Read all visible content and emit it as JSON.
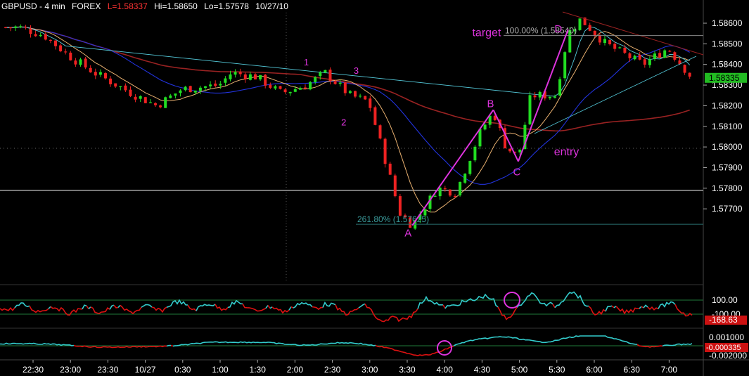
{
  "header": {
    "symbol": "GBPUSD - 4 min",
    "market": "FOREX",
    "last": "L=1.58337",
    "high": "Hi=1.58650",
    "low": "Lo=1.57578",
    "date": "10/27/10"
  },
  "colors": {
    "background": "#000000",
    "bull": "#22dd22",
    "bear": "#ee2222",
    "annotation": "#dd33dd",
    "ma_orange": "#e8b070",
    "ma_blue": "#2233dd",
    "ma_red": "#992222",
    "ma_cyan": "#55ccdd",
    "hline": "#c8c8c8",
    "osc_cyan": "#33cccc",
    "osc_red": "#dd1111"
  },
  "chart_data": [
    {
      "type": "candlestick",
      "title": "GBPUSD - 4 min",
      "ylim": [
        1.576,
        1.5866
      ],
      "yticks": [
        "1.58600",
        "1.58500",
        "1.58400",
        "1.58300",
        "1.58200",
        "1.58100",
        "1.58000",
        "1.57900",
        "1.57800",
        "1.57700"
      ],
      "x_labels": [
        "22:30",
        "23:00",
        "23:30",
        "10/27",
        "0:30",
        "1:00",
        "1:30",
        "2:00",
        "2:30",
        "3:00",
        "3:30",
        "4:00",
        "4:30",
        "5:00",
        "5:30",
        "6:00",
        "6:30",
        "7:00"
      ],
      "last_price_label": "1.58335",
      "horizontal_line": 1.5779,
      "series_close_path": [
        {
          "t": "22:20",
          "v": 1.5858
        },
        {
          "t": "22:40",
          "v": 1.5854
        },
        {
          "t": "23:00",
          "v": 1.5844
        },
        {
          "t": "23:20",
          "v": 1.5836
        },
        {
          "t": "23:50",
          "v": 1.5826
        },
        {
          "t": "0:10",
          "v": 1.582
        },
        {
          "t": "0:30",
          "v": 1.5828
        },
        {
          "t": "1:00",
          "v": 1.583
        },
        {
          "t": "1:10",
          "v": 1.5836
        },
        {
          "t": "1:30",
          "v": 1.5834
        },
        {
          "t": "1:50",
          "v": 1.5826
        },
        {
          "t": "2:10",
          "v": 1.583
        },
        {
          "t": "2:25",
          "v": 1.5836
        },
        {
          "t": "2:45",
          "v": 1.5825
        },
        {
          "t": "3:00",
          "v": 1.5822
        },
        {
          "t": "3:15",
          "v": 1.579
        },
        {
          "t": "3:25",
          "v": 1.5768
        },
        {
          "t": "3:35",
          "v": 1.5762
        },
        {
          "t": "3:55",
          "v": 1.578
        },
        {
          "t": "4:10",
          "v": 1.5778
        },
        {
          "t": "4:30",
          "v": 1.5808
        },
        {
          "t": "4:40",
          "v": 1.5817
        },
        {
          "t": "4:50",
          "v": 1.58
        },
        {
          "t": "5:00",
          "v": 1.5795
        },
        {
          "t": "5:10",
          "v": 1.5825
        },
        {
          "t": "5:30",
          "v": 1.5825
        },
        {
          "t": "5:40",
          "v": 1.5855
        },
        {
          "t": "5:50",
          "v": 1.5862
        },
        {
          "t": "6:10",
          "v": 1.585
        },
        {
          "t": "6:40",
          "v": 1.584
        },
        {
          "t": "7:00",
          "v": 1.5848
        },
        {
          "t": "7:20",
          "v": 1.5833
        }
      ],
      "annotations": [
        {
          "text": "1",
          "t": "2:10",
          "v": 1.58395
        },
        {
          "text": "2",
          "t": "2:40",
          "v": 1.58105
        },
        {
          "text": "3",
          "t": "2:50",
          "v": 1.58355
        },
        {
          "text": "A",
          "t": "3:35",
          "v": 1.5762
        },
        {
          "text": "B",
          "t": "4:40",
          "v": 1.5818
        },
        {
          "text": "C",
          "t": "5:00",
          "v": 1.5793
        },
        {
          "text": "D",
          "t": "5:40",
          "v": 1.5857
        },
        {
          "text": "entry",
          "t": "5:15",
          "v": 1.5796
        },
        {
          "text": "target",
          "t": "5:00",
          "v": 1.5855
        }
      ],
      "fib_labels": [
        {
          "text": "100.00% (1.58540)",
          "price": 1.5854
        },
        {
          "text": "261.80% (1.57625)",
          "price": 1.57625
        }
      ],
      "pattern_lines": [
        {
          "from": "A",
          "to": "B"
        },
        {
          "from": "B",
          "to": "C"
        },
        {
          "from": "C",
          "to": "D"
        }
      ]
    },
    {
      "type": "line",
      "title": "",
      "yticks": [
        "100.00",
        "-100.00"
      ],
      "last_value_label": "-168.63",
      "levels": [
        100,
        -100
      ]
    },
    {
      "type": "line",
      "title": "",
      "yticks": [
        "0.001000",
        "-0.002000"
      ],
      "last_value_label": "-0.000335",
      "levels": [
        0
      ]
    }
  ]
}
